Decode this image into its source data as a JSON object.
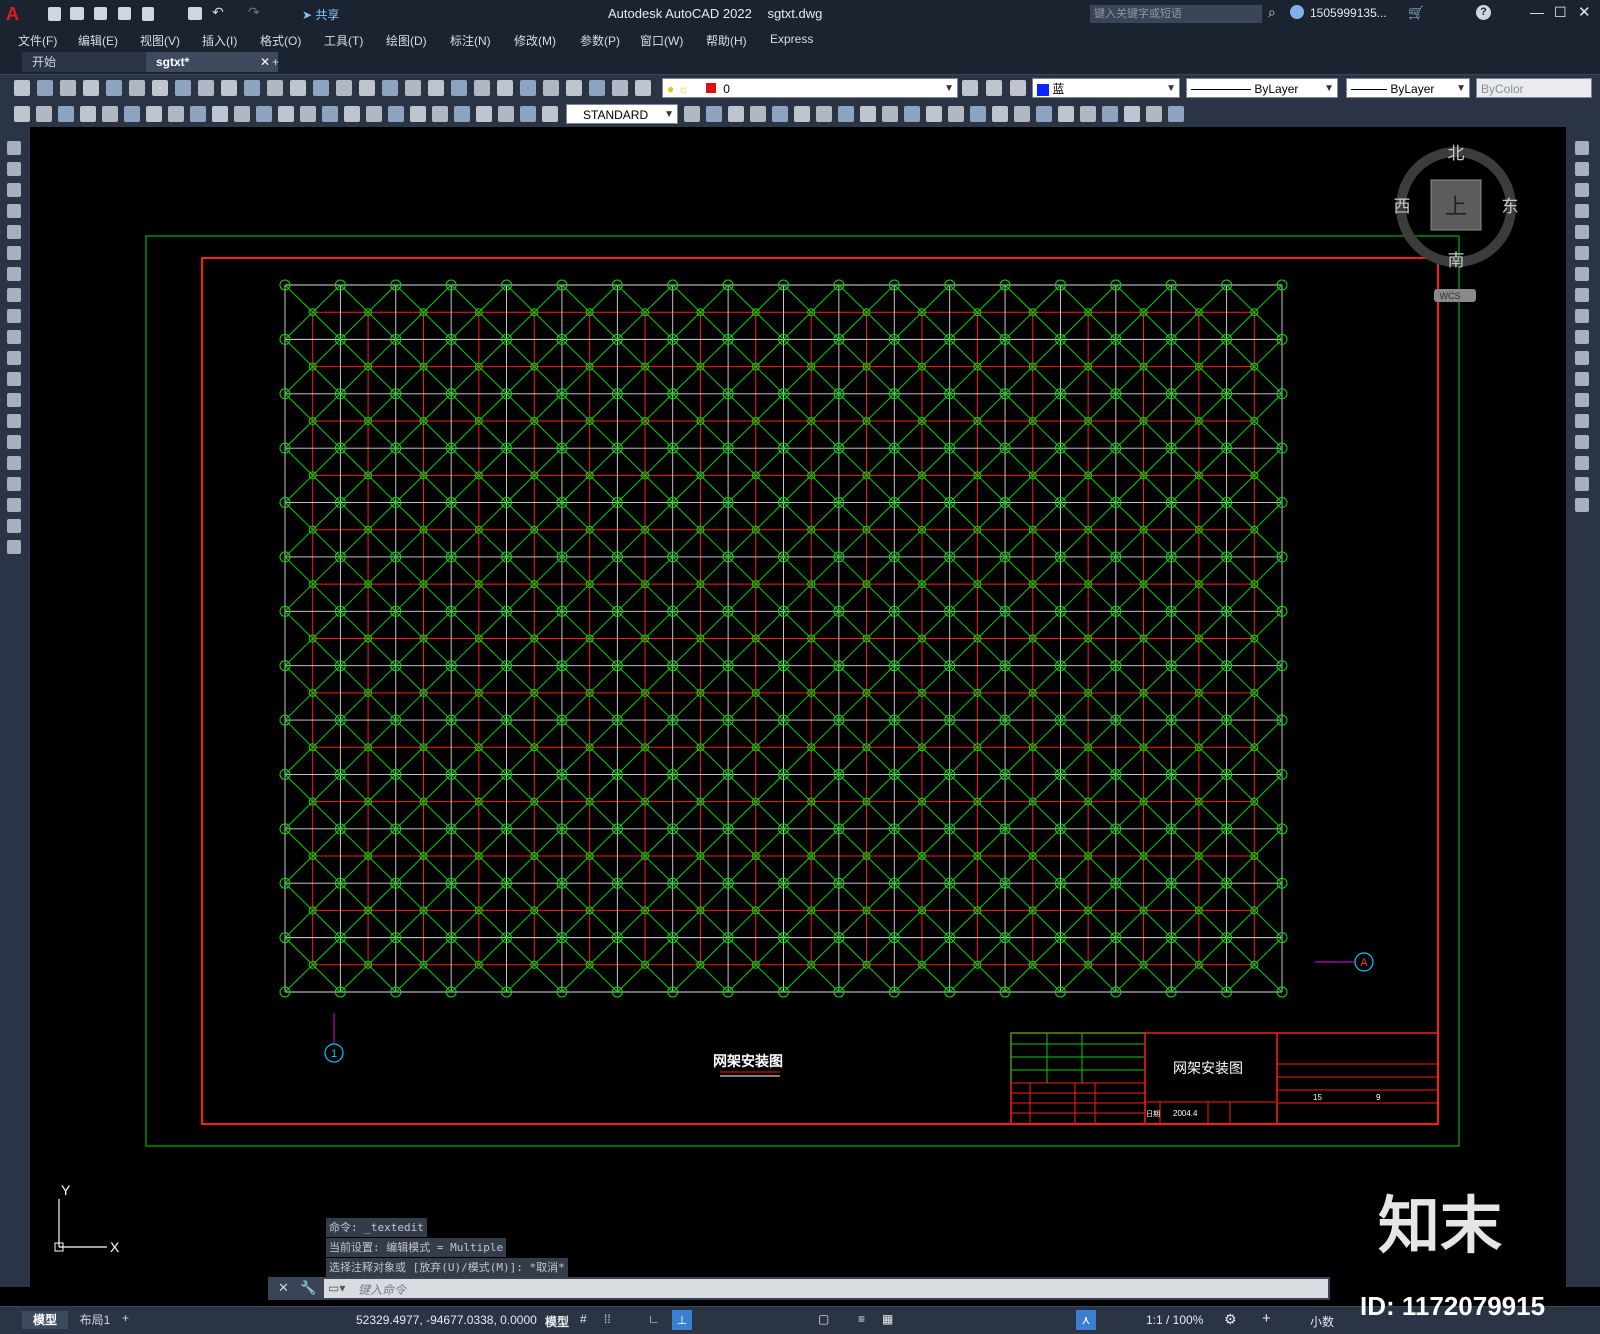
{
  "app": {
    "title": "Autodesk AutoCAD 2022",
    "filename": "sgtxt.dwg",
    "share_label": "共享",
    "search_placeholder": "键入关键字或短语",
    "user": "1505999135...",
    "colors": {
      "bg": "#000000",
      "chrome": "#1b2330",
      "toolbar": "#2a3444",
      "grid_green": "#00e000",
      "frame_red": "#ff1a1a",
      "frame_green": "#00b400",
      "grid_white": "#dcdcdc",
      "axis_cyan": "#00c8ff",
      "axis_magenta": "#c000c0"
    }
  },
  "menu": [
    "文件(F)",
    "编辑(E)",
    "视图(V)",
    "插入(I)",
    "格式(O)",
    "工具(T)",
    "绘图(D)",
    "标注(N)",
    "修改(M)",
    "参数(P)",
    "窗口(W)",
    "帮助(H)",
    "Express"
  ],
  "tabs": [
    {
      "label": "开始"
    },
    {
      "label": "sgtxt*"
    }
  ],
  "toolbar": {
    "layer_value": "0",
    "color_value": "蓝",
    "linetype_value": "ByLayer",
    "lineweight_value": "ByLayer",
    "plotstyle_value": "ByColor",
    "textstyle_value": "STANDARD"
  },
  "viewcube": {
    "north": "北",
    "south": "南",
    "east": "东",
    "west": "西",
    "top": "上",
    "wcs": "WCS"
  },
  "drawing": {
    "title_under": "网架安装图",
    "axis_a": "A",
    "axis_1": "1",
    "titleblock": {
      "title": "网架安装图",
      "date_label": "日期",
      "date": "2004.4",
      "sheet_a": "15",
      "sheet_b": "9"
    }
  },
  "ucs": {
    "x": "X",
    "y": "Y"
  },
  "command": {
    "history": [
      "命令:  _textedit",
      "当前设置: 编辑模式 = Multiple",
      "选择注释对象或 [放弃(U)/模式(M)]: *取消*"
    ],
    "placeholder": "键入命令"
  },
  "layout_tabs": [
    "模型",
    "布局1"
  ],
  "status": {
    "coords": "52329.4977, -94677.0338, 0.0000",
    "model": "模型",
    "scale": "1:1 / 100%",
    "units": "小数"
  },
  "watermark": {
    "brand": "知末",
    "id": "ID: 1172079915"
  }
}
